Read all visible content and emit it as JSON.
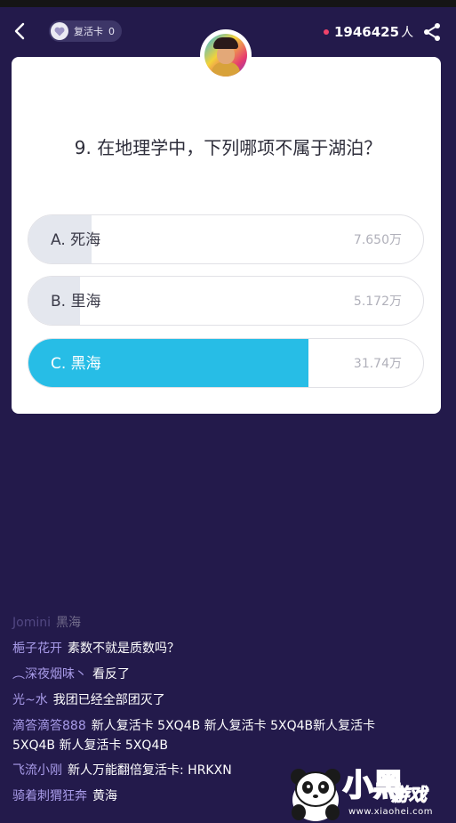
{
  "header": {
    "revive_card_label": "复活卡",
    "revive_card_count": "0",
    "online_count": "1946425",
    "online_unit": "人"
  },
  "question": {
    "text": "9. 在地理学中，下列哪项不属于湖泊？"
  },
  "options": [
    {
      "label": "A. 死海",
      "count": "7.650万",
      "fill_fraction": 0.16,
      "selected": false
    },
    {
      "label": "B. 里海",
      "count": "5.172万",
      "fill_fraction": 0.13,
      "selected": false
    },
    {
      "label": "C. 黑海",
      "count": "31.74万",
      "fill_fraction": 0.71,
      "selected": true
    }
  ],
  "chat": [
    {
      "user": "Jomini",
      "msg": "黑海",
      "faded": true
    },
    {
      "user": "梔子花开",
      "msg": "素数不就是质数吗？"
    },
    {
      "user": "︵深夜烟味丶",
      "msg": "看反了"
    },
    {
      "user": "光~水",
      "msg": "我团已经全部团灭了"
    },
    {
      "user": "滴答滴答888",
      "msg": "新人复活卡 5XQ4B  新人复活卡 5XQ4B新人复活卡"
    },
    {
      "user": "",
      "msg": "5XQ4B  新人复活卡 5XQ4B"
    },
    {
      "user": "飞流小刚",
      "msg": "新人万能翻倍复活卡:  HRKXN"
    },
    {
      "user": "骑着刺猬狂奔",
      "msg": "黄海"
    }
  ],
  "watermark": {
    "word": "小黑",
    "word2": "游戏",
    "url": "www.xiaohei.com"
  },
  "colors": {
    "background": "#231a4b",
    "selected": "#27bde6",
    "dot": "#f0436a",
    "username": "#a89be8"
  }
}
